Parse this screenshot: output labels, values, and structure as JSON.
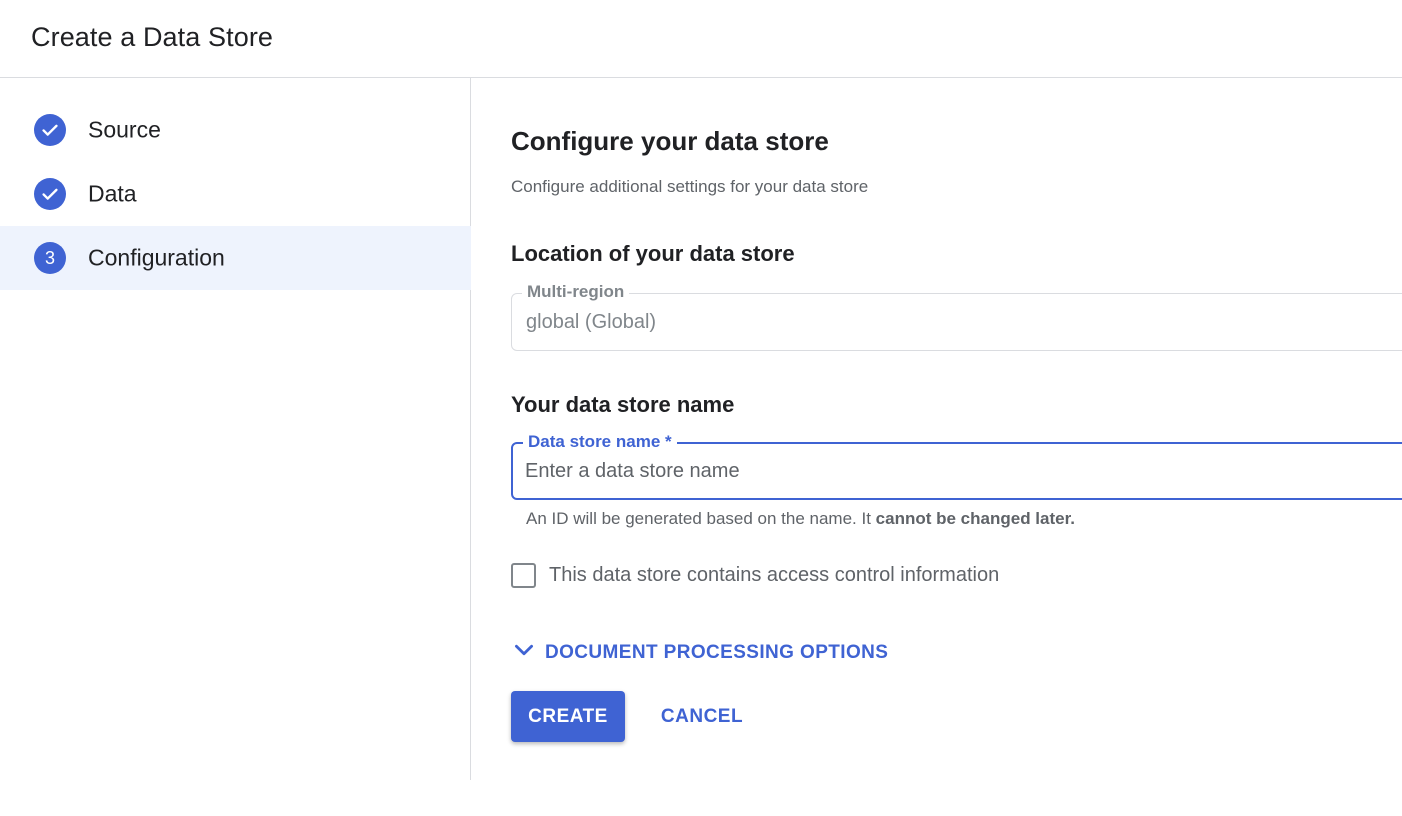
{
  "header": {
    "title": "Create a Data Store"
  },
  "steps": [
    {
      "label": "Source",
      "state": "complete",
      "icon": "check-icon"
    },
    {
      "label": "Data",
      "state": "complete",
      "icon": "check-icon"
    },
    {
      "label": "Configuration",
      "state": "active",
      "number": "3"
    }
  ],
  "main": {
    "title": "Configure your data store",
    "subtitle": "Configure additional settings for your data store",
    "location": {
      "heading": "Location of your data store",
      "field_label": "Multi-region",
      "value": "global (Global)"
    },
    "name": {
      "heading": "Your data store name",
      "field_label": "Data store name *",
      "placeholder": "Enter a data store name",
      "value": "",
      "hint_prefix": "An ID will be generated based on the name. It ",
      "hint_bold": "cannot be changed later."
    },
    "access_control": {
      "label": "This data store contains access control information",
      "checked": false
    },
    "document_processing": {
      "label": "DOCUMENT PROCESSING OPTIONS",
      "icon": "chevron-down-icon"
    },
    "actions": {
      "create_label": "CREATE",
      "cancel_label": "CANCEL"
    }
  },
  "colors": {
    "accent": "#3f63d3",
    "active_step_bg": "#eef3fd",
    "divider": "#dadce0"
  }
}
